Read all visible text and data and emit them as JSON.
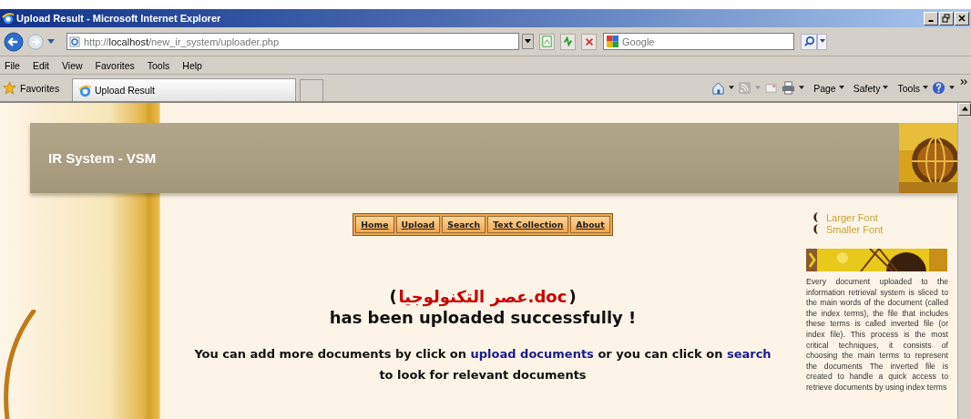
{
  "window": {
    "title": "Upload Result - Microsoft Internet Explorer"
  },
  "address_bar": {
    "url": "http://**localhost**/new_ir_system/uploader.php"
  },
  "search_box": {
    "placeholder": "Google"
  },
  "menu": [
    "File",
    "Edit",
    "View",
    "Favorites",
    "Tools",
    "Help"
  ],
  "favorites_bar": {
    "label": "Favorites",
    "tabs": [
      {
        "label": "Upload Result",
        "selected": true
      }
    ]
  },
  "command_bar": [
    "Page",
    "Safety",
    "Tools"
  ],
  "page": {
    "site_title": "IR System - VSM",
    "nav": [
      "Home",
      "Upload",
      "Search",
      "Text Collection",
      "About"
    ],
    "result": {
      "open": "(",
      "file_name": "عصر التكنولوجيا.doc",
      "close": ")",
      "message": "has been uploaded successfully !",
      "hint": [
        {
          "kind": "text",
          "text": "You can add more documents by click on "
        },
        {
          "kind": "link",
          "text": "upload documents"
        },
        {
          "kind": "text",
          "text": " or you can click on "
        },
        {
          "kind": "link",
          "text": "search"
        },
        {
          "kind": "text",
          "text": " to look for relevant documents"
        }
      ]
    },
    "sidebar": {
      "font_links": [
        "Larger Font",
        "Smaller Font"
      ],
      "text": "Every document uploaded to the information retrieval system is sliced to the main words of the document (called the index terms), the file that includes these terms is called inverted file (or index file). This process is the most critical techniques, it consists of choosing the main terms to represent the documents The inverted file is created to handle a quick access to retrieve documents by using index terms"
    }
  }
}
